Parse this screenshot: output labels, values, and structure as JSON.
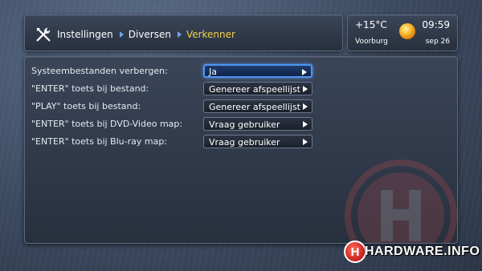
{
  "breadcrumb": {
    "items": [
      "Instellingen",
      "Diversen",
      "Verkenner"
    ],
    "icon": "tools-icon"
  },
  "weather": {
    "temperature": "+15°C",
    "time": "09:59",
    "location": "Voorburg",
    "date": "sep 26",
    "icon": "sun-icon"
  },
  "settings": {
    "rows": [
      {
        "label": "Systeembestanden verbergen:",
        "value": "Ja"
      },
      {
        "label": "\"ENTER\" toets bij bestand:",
        "value": "Genereer afspeellijst"
      },
      {
        "label": "\"PLAY\" toets bij bestand:",
        "value": "Genereer afspeellijst"
      },
      {
        "label": "\"ENTER\" toets bij DVD-Video map:",
        "value": "Vraag gebruiker"
      },
      {
        "label": "\"ENTER\" toets bij Blu-ray map:",
        "value": "Vraag gebruiker"
      }
    ]
  },
  "watermark": {
    "logo_text": "HARDWARE.INFO",
    "badge_letter": "H"
  },
  "colors": {
    "accent_focus": "#4f95f0",
    "breadcrumb_active": "#f0d24a",
    "logo_red": "#c8201e"
  }
}
